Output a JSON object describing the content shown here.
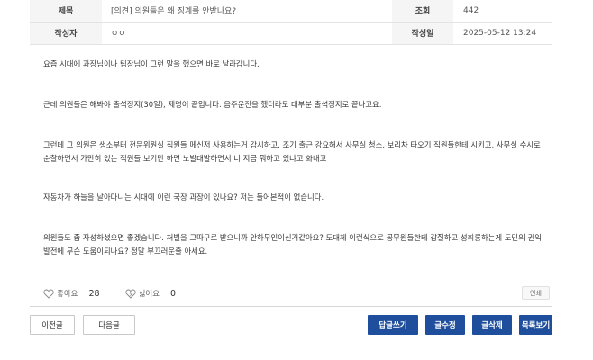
{
  "meta": {
    "title_label": "제목",
    "title_value": "[의견] 의원들은 왜 징계를 안받나요?",
    "views_label": "조회",
    "views_value": "442",
    "author_label": "작성자",
    "author_value": "ㅇㅇ",
    "date_label": "작성일",
    "date_value": "2025-05-12 13:24"
  },
  "content": {
    "paragraphs": [
      "요즘 시대에 과장님이나 팀장님이 그런 말을 했으면 바로 날라갑니다.",
      "근데 의원들은 해봐야 출석정지(30일), 제명이 끝입니다. 음주운전을 했더라도 대부분 출석정지로 끝나고요.",
      "그런데 그 의원은 생소부터 전문위원실 직원들 메신저 사용하는거 감시하고, 조기 출근 강요해서 사무실 청소, 보리차 타오기 직원들한테 시키고, 사무실 수시로 순찰하면서 가만히 있는 직원들 보기만 하면 노발대발하면서 너 지금 뭐하고 있냐고 화내고",
      "자동차가 하늘을 날아다니는 시대에 이런 국장 과장이 있나요? 저는 들어본적이 없습니다.",
      "의원들도 좀 자성하셨으면 좋겠습니다. 처벌을 그따구로 받으니까 안하무인이신거같아요? 도대체 이런식으로 공무원들한테 갑질하고 성희롱하는게 도민의 권익 발전에 무슨 도움이되나요? 정말 부끄러운줄 아세요."
    ]
  },
  "reactions": {
    "like_label": "좋아요",
    "like_count": "28",
    "dislike_label": "싫어요",
    "dislike_count": "0",
    "print_label": "인쇄"
  },
  "buttons": {
    "prev": "이전글",
    "next": "다음글",
    "reply": "답글쓰기",
    "edit": "글수정",
    "delete": "글삭제",
    "list": "목록보기"
  },
  "colors": {
    "accent": "#1f4f9c",
    "header_bg": "#f5f5f5"
  }
}
